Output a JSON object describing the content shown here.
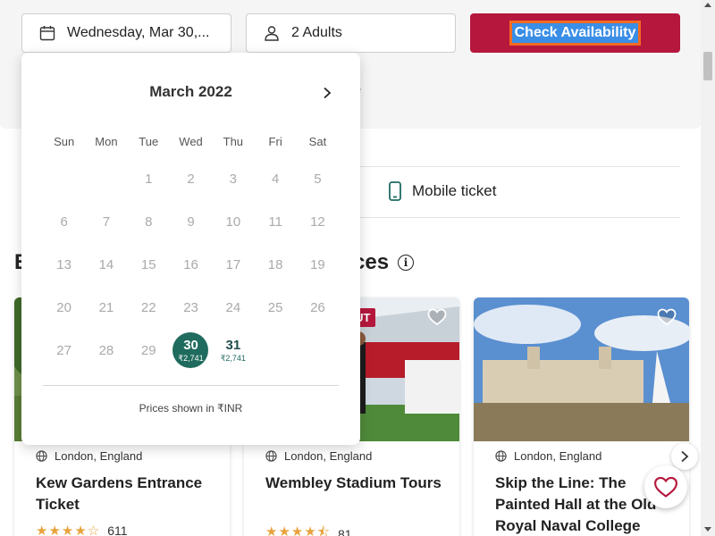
{
  "search_bar": {
    "date_value": "Wednesday, Mar 30,...",
    "guests_value": "2 Adults",
    "cta_label": "Check Availability"
  },
  "features": {
    "mobile_ticket_label": "Mobile ticket",
    "partial_text": ")",
    "ghost_text": "e"
  },
  "section": {
    "title_start": "E",
    "title_end": "ces"
  },
  "calendar": {
    "month": "March 2022",
    "weekdays": [
      "Sun",
      "Mon",
      "Tue",
      "Wed",
      "Thu",
      "Fri",
      "Sat"
    ],
    "weeks": [
      [
        {
          "d": ""
        },
        {
          "d": ""
        },
        {
          "d": "1"
        },
        {
          "d": "2"
        },
        {
          "d": "3"
        },
        {
          "d": "4"
        },
        {
          "d": "5"
        }
      ],
      [
        {
          "d": "6"
        },
        {
          "d": "7"
        },
        {
          "d": "8"
        },
        {
          "d": "9"
        },
        {
          "d": "10"
        },
        {
          "d": "11"
        },
        {
          "d": "12"
        }
      ],
      [
        {
          "d": "13"
        },
        {
          "d": "14"
        },
        {
          "d": "15"
        },
        {
          "d": "16"
        },
        {
          "d": "17"
        },
        {
          "d": "18"
        },
        {
          "d": "19"
        }
      ],
      [
        {
          "d": "20"
        },
        {
          "d": "21"
        },
        {
          "d": "22"
        },
        {
          "d": "23"
        },
        {
          "d": "24"
        },
        {
          "d": "25"
        },
        {
          "d": "26"
        }
      ],
      [
        {
          "d": "27"
        },
        {
          "d": "28"
        },
        {
          "d": "29"
        },
        {
          "d": "30",
          "price": "₹2,741",
          "state": "selected"
        },
        {
          "d": "31",
          "price": "₹2,741",
          "state": "active"
        },
        {
          "d": ""
        },
        {
          "d": ""
        }
      ]
    ],
    "price_note": "Prices shown in ₹INR"
  },
  "cards": [
    {
      "location": "London, England",
      "title": "Kew Gardens Entrance Ticket",
      "rating": 4.0,
      "reviews": "611",
      "badge": ""
    },
    {
      "location": "London, England",
      "title": "Wembley Stadium Tours",
      "rating": 4.5,
      "reviews": "81",
      "badge": "OUT"
    },
    {
      "location": "London, England",
      "title": "Skip the Line: The Painted Hall at the Old Royal Naval College",
      "rating": null,
      "reviews": "",
      "badge": ""
    }
  ],
  "colors": {
    "brand": "#b5173d",
    "selected_day": "#1f6b5e",
    "star": "#e8a33d"
  },
  "icons": [
    "calendar-icon",
    "person-icon",
    "chevron-right-icon",
    "mobile-icon",
    "info-icon",
    "globe-icon",
    "heart-icon"
  ]
}
